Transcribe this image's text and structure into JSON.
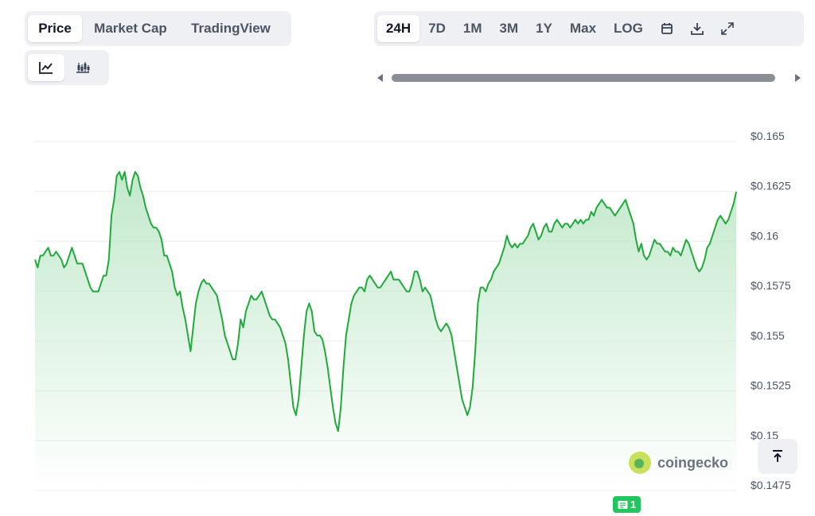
{
  "view_tabs": {
    "price": "Price",
    "market_cap": "Market Cap",
    "tradingview": "TradingView",
    "active": "Price"
  },
  "chart_type": {
    "line_icon": "line-chart-icon",
    "candle_icon": "candlestick-icon",
    "active": "line"
  },
  "range_tabs": {
    "h24": "24H",
    "d7": "7D",
    "m1": "1M",
    "m3": "3M",
    "y1": "1Y",
    "max": "Max",
    "log": "LOG",
    "active": "24H"
  },
  "tool_icons": [
    "calendar-icon",
    "download-icon",
    "fullscreen-icon"
  ],
  "watermark": {
    "text": "coingecko",
    "icon": "coingecko-logo"
  },
  "news_badge": {
    "count": "1",
    "icon": "newspaper-icon"
  },
  "colors": {
    "line": "#22a83d",
    "fill_top": "#bfe8c9",
    "grid": "#ececec",
    "axis_text": "#4b5563",
    "badge": "#22c55e"
  },
  "chart_data": {
    "type": "area",
    "y_ticks": [
      "$0.165",
      "$0.1625",
      "$0.16",
      "$0.1575",
      "$0.155",
      "$0.1525",
      "$0.15",
      "$0.1475"
    ],
    "y_tick_values": [
      0.165,
      0.1625,
      0.16,
      0.1575,
      0.155,
      0.1525,
      0.15,
      0.1475
    ],
    "ylim": [
      0.1475,
      0.165
    ],
    "grid": true,
    "x_range": "24H",
    "values": [
      0.15908,
      0.15868,
      0.15928,
      0.15928,
      0.15948,
      0.15968,
      0.15928,
      0.15928,
      0.15948,
      0.15928,
      0.15908,
      0.15868,
      0.15888,
      0.15928,
      0.15968,
      0.15928,
      0.15888,
      0.15888,
      0.15888,
      0.15848,
      0.15808,
      0.15768,
      0.15748,
      0.15748,
      0.15748,
      0.15788,
      0.15828,
      0.15828,
      0.15908,
      0.16128,
      0.16208,
      0.16328,
      0.16348,
      0.16308,
      0.16348,
      0.16268,
      0.16228,
      0.16308,
      0.16348,
      0.16328,
      0.16268,
      0.16228,
      0.16168,
      0.16128,
      0.16088,
      0.16068,
      0.16068,
      0.16048,
      0.16008,
      0.15928,
      0.15928,
      0.15888,
      0.15848,
      0.15768,
      0.15728,
      0.15748,
      0.15668,
      0.15608,
      0.15528,
      0.15448,
      0.15568,
      0.15688,
      0.15748,
      0.15788,
      0.15808,
      0.15788,
      0.15788,
      0.15768,
      0.15748,
      0.15728,
      0.15668,
      0.15608,
      0.15528,
      0.15488,
      0.15448,
      0.15408,
      0.15408,
      0.15488,
      0.15608,
      0.15568,
      0.15648,
      0.15688,
      0.15728,
      0.15708,
      0.15708,
      0.15728,
      0.15748,
      0.15708,
      0.15668,
      0.15628,
      0.15608,
      0.15608,
      0.15588,
      0.15568,
      0.15528,
      0.15488,
      0.15408,
      0.15288,
      0.15168,
      0.15128,
      0.15208,
      0.15368,
      0.15528,
      0.15648,
      0.15688,
      0.15648,
      0.15548,
      0.15528,
      0.15528,
      0.15508,
      0.15448,
      0.15368,
      0.15268,
      0.15168,
      0.15088,
      0.15048,
      0.15168,
      0.15368,
      0.15528,
      0.15608,
      0.15688,
      0.15728,
      0.15748,
      0.15768,
      0.15768,
      0.15748,
      0.15808,
      0.15828,
      0.15808,
      0.15788,
      0.15768,
      0.15768,
      0.15788,
      0.15808,
      0.15828,
      0.15848,
      0.15808,
      0.15808,
      0.15808,
      0.15788,
      0.15768,
      0.15748,
      0.15748,
      0.15788,
      0.15848,
      0.15848,
      0.15808,
      0.15748,
      0.15768,
      0.15748,
      0.15728,
      0.15668,
      0.15608,
      0.15568,
      0.15548,
      0.15568,
      0.15588,
      0.15568,
      0.15528,
      0.15448,
      0.15368,
      0.15288,
      0.15208,
      0.15168,
      0.15128,
      0.15168,
      0.15268,
      0.15448,
      0.15688,
      0.15768,
      0.15768,
      0.15748,
      0.15788,
      0.15808,
      0.15848,
      0.15868,
      0.15888,
      0.15928,
      0.15968,
      0.16028,
      0.15988,
      0.15968,
      0.15988,
      0.15968,
      0.15988,
      0.15988,
      0.16008,
      0.16028,
      0.16068,
      0.16088,
      0.16048,
      0.16008,
      0.16028,
      0.16068,
      0.16088,
      0.16048,
      0.16048,
      0.16088,
      0.16108,
      0.16088,
      0.16068,
      0.16088,
      0.16088,
      0.16068,
      0.16088,
      0.16108,
      0.16088,
      0.16108,
      0.16088,
      0.16108,
      0.16108,
      0.16148,
      0.16128,
      0.16168,
      0.16188,
      0.16208,
      0.16188,
      0.16168,
      0.16168,
      0.16148,
      0.16128,
      0.16148,
      0.16168,
      0.16188,
      0.16208,
      0.16168,
      0.16128,
      0.16088,
      0.16008,
      0.15948,
      0.15988,
      0.15928,
      0.15908,
      0.15928,
      0.15968,
      0.16008,
      0.15988,
      0.15988,
      0.15968,
      0.15948,
      0.15948,
      0.15928,
      0.15968,
      0.15948,
      0.15948,
      0.15928,
      0.15968,
      0.16008,
      0.15988,
      0.15948,
      0.15908,
      0.15868,
      0.15848,
      0.15868,
      0.15908,
      0.15968,
      0.15988,
      0.16028,
      0.16068,
      0.16108,
      0.16128,
      0.16108,
      0.16088,
      0.16108,
      0.16148,
      0.16188,
      0.16248
    ]
  }
}
